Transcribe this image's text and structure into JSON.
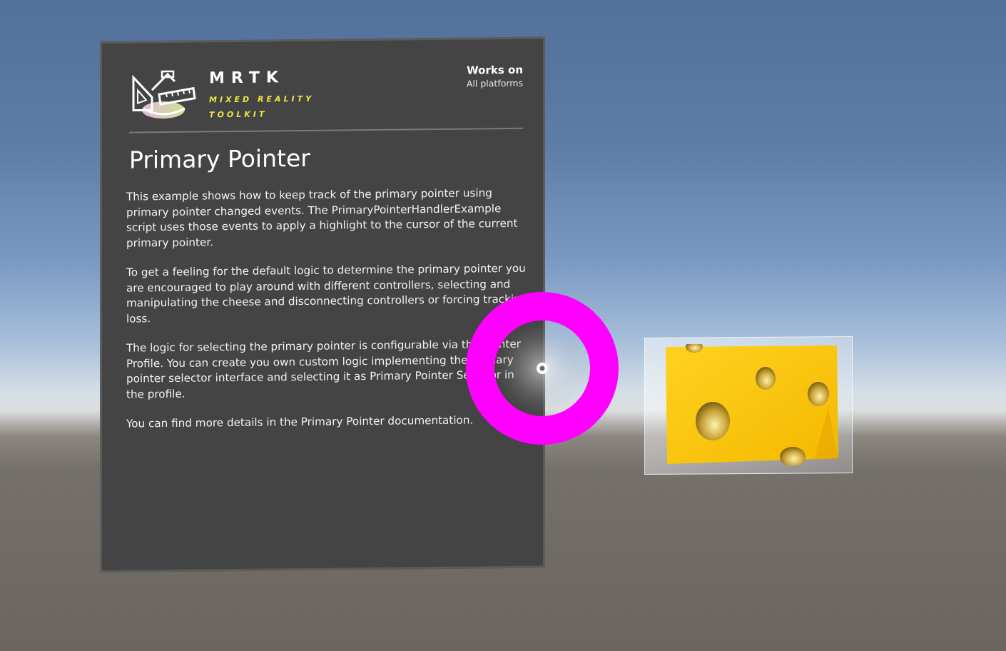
{
  "logo": {
    "title": "MRTK",
    "subtitle": "MIXED REALITY TOOLKIT",
    "icon": "mrtk-logo-icon"
  },
  "works_on": {
    "title": "Works on",
    "value": "All platforms"
  },
  "page": {
    "title": "Primary Pointer",
    "paragraphs": [
      "This example shows how to keep track of the primary pointer using primary pointer changed events. The PrimaryPointerHandlerExample script uses those events to apply a highlight to the cursor of the current primary pointer.",
      "To get a feeling for the default logic to determine the primary pointer you are encouraged to play around with different controllers, selecting and manipulating the cheese and disconnecting controllers or forcing tracking loss.",
      "The logic for selecting the primary pointer is configurable via the Pointer Profile. You can create you own custom logic implementing the primary pointer selector interface and selecting it as Primary Pointer Selector in the profile.",
      "You can find more details in the Primary Pointer documentation."
    ]
  },
  "scene_objects": {
    "cheese": "cheese-object",
    "cursor": "primary-pointer-cursor"
  },
  "colors": {
    "panel": "#444444",
    "accent_yellow": "#f0e34a",
    "cursor_highlight": "#ff00ff",
    "cheese": "#ffcc1a"
  }
}
